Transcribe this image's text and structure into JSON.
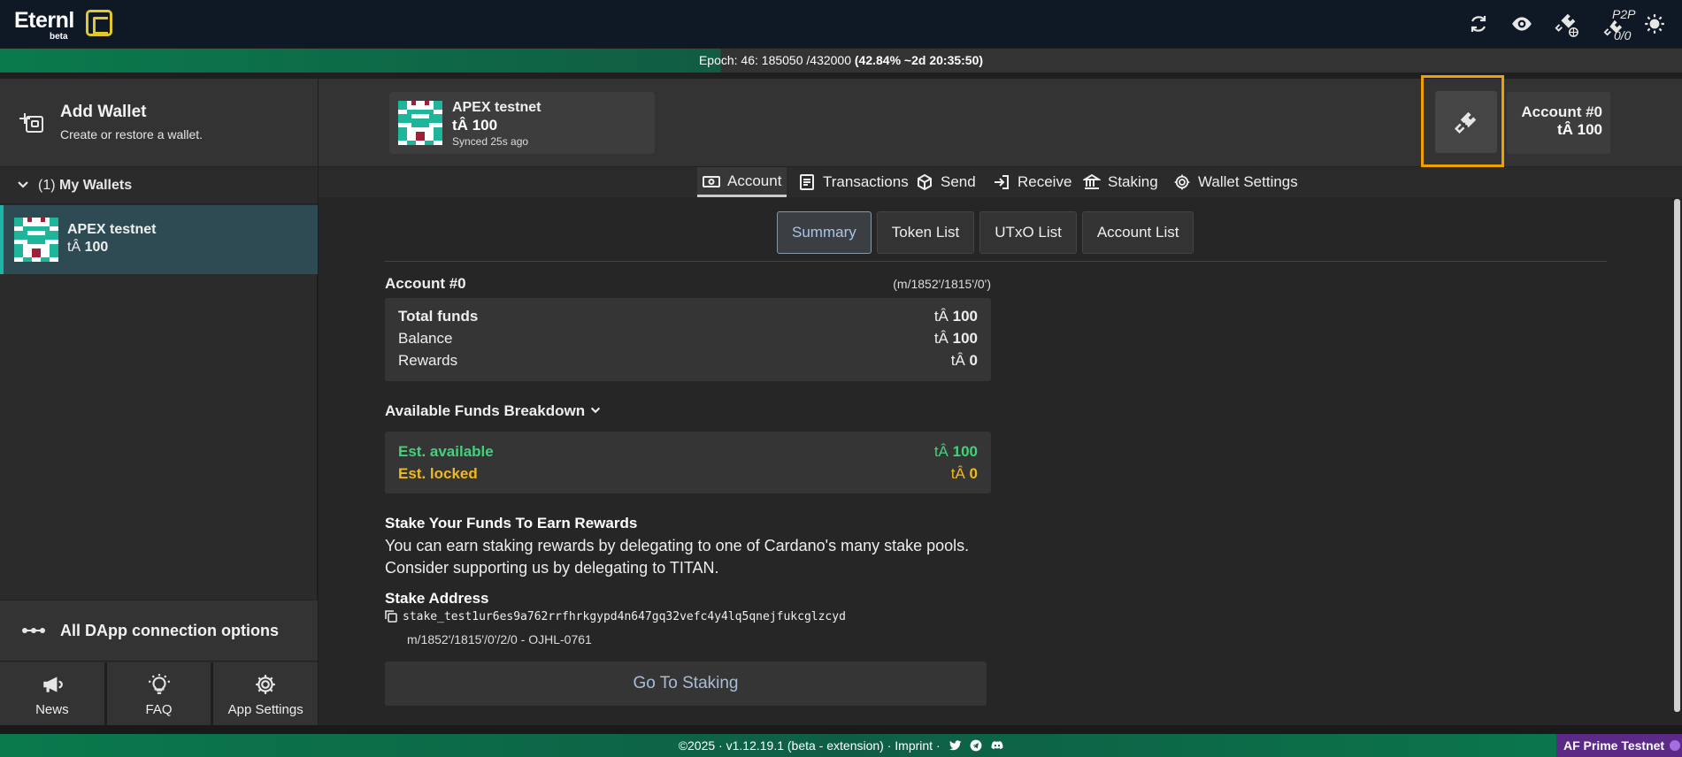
{
  "topbar": {
    "app_name": "Eternl",
    "beta_label": "beta",
    "icons": [
      "sync-icon",
      "eye-icon",
      "plug-globe-icon",
      "plug-p2p-icon",
      "sun-icon"
    ],
    "p2p_label": "P2P",
    "p2p_count": "0/0"
  },
  "epoch": {
    "label": "Epoch: 46:",
    "slot": "185050",
    "total": "/432000",
    "progress_text": "(42.84%  ~2d 20:35:50)",
    "progress_percent": 42.84
  },
  "sidebar": {
    "add_wallet_title": "Add Wallet",
    "add_wallet_sub": "Create or restore a wallet.",
    "group_count": "(1)",
    "group_label": "My Wallets",
    "wallet_name": "APEX testnet",
    "wallet_currency": "tÂ",
    "wallet_balance": "100",
    "dapp_options": "All DApp connection options",
    "buttons": [
      {
        "label": "News",
        "icon": "megaphone-icon"
      },
      {
        "label": "FAQ",
        "icon": "lightbulb-icon"
      },
      {
        "label": "App Settings",
        "icon": "gear-icon"
      }
    ]
  },
  "header": {
    "wallet_name": "APEX testnet",
    "wallet_currency": "tÂ",
    "wallet_balance": "100",
    "synced_label": "Synced",
    "synced_ago": "25s ago",
    "account_name": "Account #0",
    "account_currency": "tÂ",
    "account_balance": "100"
  },
  "tabs": [
    "Account",
    "Transactions",
    "Send",
    "Receive",
    "Staking",
    "Wallet Settings"
  ],
  "subtabs": [
    "Summary",
    "Token List",
    "UTxO List",
    "Account List"
  ],
  "account": {
    "title": "Account #0",
    "path": "(m/1852'/1815'/0')",
    "total_funds_label": "Total funds",
    "total_funds_currency": "tÂ",
    "total_funds_value": "100",
    "balance_label": "Balance",
    "balance_currency": "tÂ",
    "balance_value": "100",
    "rewards_label": "Rewards",
    "rewards_currency": "tÂ",
    "rewards_value": "0"
  },
  "breakdown": {
    "title": "Available Funds Breakdown",
    "available_label": "Est. available",
    "available_currency": "tÂ",
    "available_value": "100",
    "locked_label": "Est. locked",
    "locked_currency": "tÂ",
    "locked_value": "0"
  },
  "stake": {
    "title": "Stake Your Funds To Earn Rewards",
    "line1": "You can earn staking rewards by delegating to one of Cardano's many stake pools.",
    "line2": "Consider supporting us by delegating to TITAN.",
    "address_title": "Stake Address",
    "address": "stake_test1ur6es9a762rrfhrkgypd4n647gq32vefc4y4lq5qnejfukcglzcyd",
    "address_path": "m/1852'/1815'/0'/2/0 - OJHL-0761",
    "go_button": "Go To Staking"
  },
  "footer": {
    "text": "©2025 · v1.12.19.1 (beta - extension) · Imprint ·",
    "network": "AF Prime Testnet"
  },
  "colors": {
    "accent_green": "#41d37a",
    "accent_yellow": "#f0b820",
    "highlight": "#f0a000"
  }
}
